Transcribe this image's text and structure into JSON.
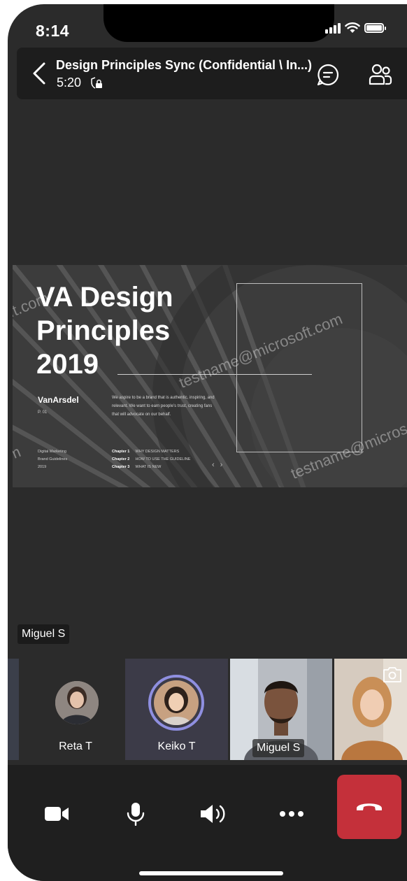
{
  "status_bar": {
    "time": "8:14"
  },
  "header": {
    "title": "Design Principles Sync (Confidential \\ In...)",
    "duration": "5:20"
  },
  "slide": {
    "title": "VA Design Principles 2019",
    "logo": "VanArsdel",
    "page": "P. 01",
    "paragraph": "We aspire to be a brand that is authentic, inspiring, and relevant. We want to earn people’s trust, creating fans that will advocate on our behalf.",
    "footer_left": [
      "Digital Marketing",
      "Brand Guidelines",
      "2019"
    ],
    "chapters": [
      {
        "label": "Chapter 1",
        "text": "WHY DESIGN MATTERS"
      },
      {
        "label": "Chapter 2",
        "text": "HOW TO USE THE GUIDELINE"
      },
      {
        "label": "Chapter 3",
        "text": "WHAT IS NEW"
      }
    ],
    "watermark": "testname@microsoft.com"
  },
  "speaker_label": "Miguel S",
  "participants": [
    {
      "name": "Reta T"
    },
    {
      "name": "Keiko T"
    },
    {
      "name": "Miguel S"
    }
  ],
  "colors": {
    "end_call": "#c4303a",
    "active_ring": "#8f8fe0"
  }
}
